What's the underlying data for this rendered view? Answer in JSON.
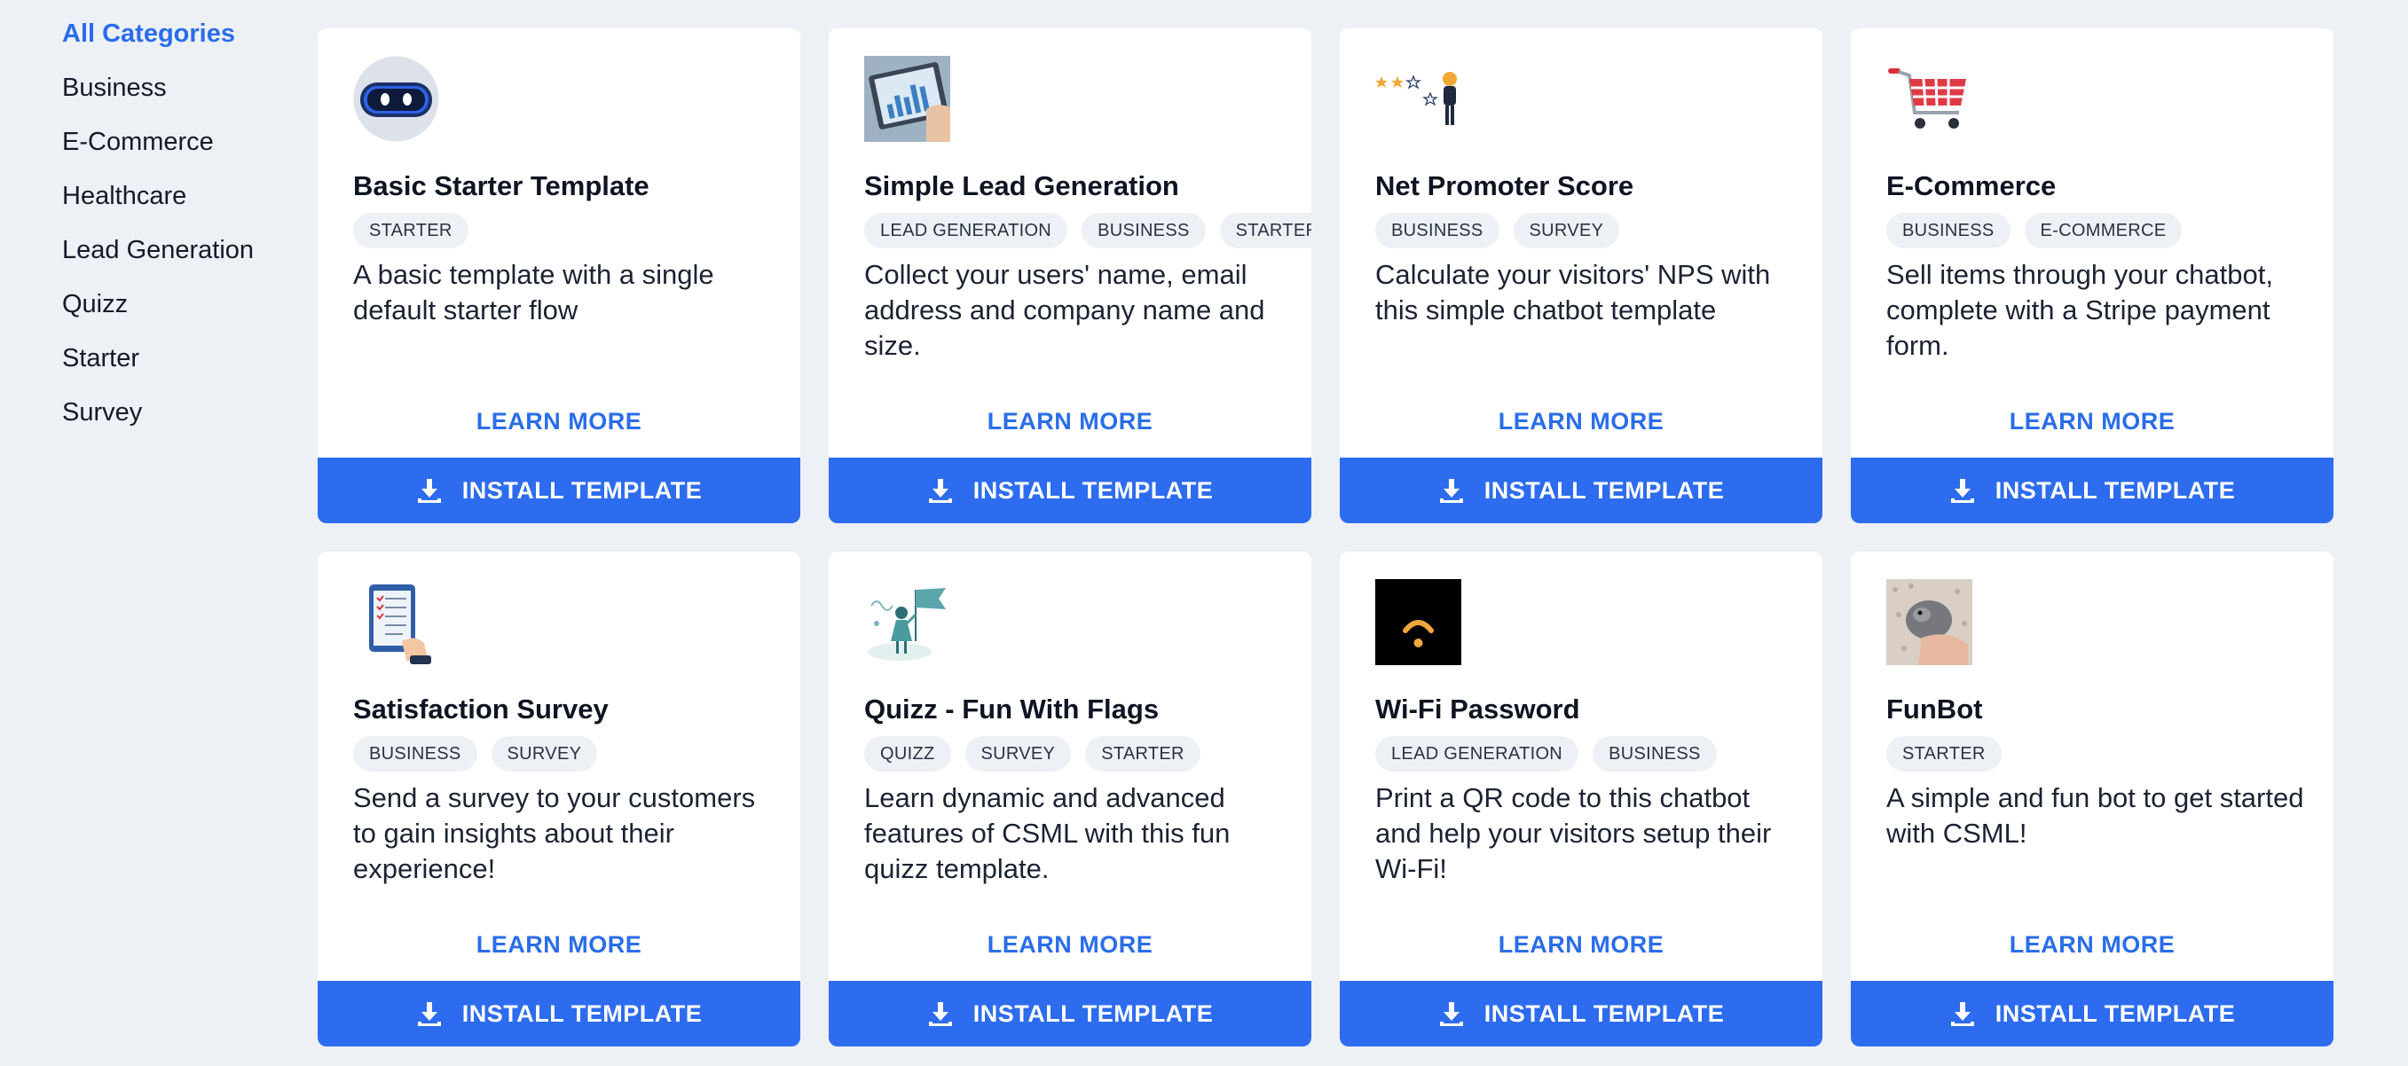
{
  "sidebar": {
    "items": [
      {
        "label": "All Categories",
        "active": true
      },
      {
        "label": "Business"
      },
      {
        "label": "E-Commerce"
      },
      {
        "label": "Healthcare"
      },
      {
        "label": "Lead Generation"
      },
      {
        "label": "Quizz"
      },
      {
        "label": "Starter"
      },
      {
        "label": "Survey"
      }
    ]
  },
  "cards": [
    {
      "title": "Basic Starter Template",
      "icon": "robot-face-icon",
      "tags": [
        "STARTER"
      ],
      "description": "A basic template with a single default starter flow",
      "learn_more": "LEARN MORE",
      "install": "INSTALL TEMPLATE"
    },
    {
      "title": "Simple Lead Generation",
      "icon": "tablet-chart-photo-icon",
      "tags": [
        "LEAD GENERATION",
        "BUSINESS",
        "STARTER"
      ],
      "description": "Collect your users' name, email address and company name and size.",
      "learn_more": "LEARN MORE",
      "install": "INSTALL TEMPLATE"
    },
    {
      "title": "Net Promoter Score",
      "icon": "star-rating-icon",
      "tags": [
        "BUSINESS",
        "SURVEY"
      ],
      "description": "Calculate your visitors' NPS with this simple chatbot template",
      "learn_more": "LEARN MORE",
      "install": "INSTALL TEMPLATE"
    },
    {
      "title": "E-Commerce",
      "icon": "shopping-cart-icon",
      "tags": [
        "BUSINESS",
        "E-COMMERCE"
      ],
      "description": "Sell items through your chatbot, complete with a Stripe payment form.",
      "learn_more": "LEARN MORE",
      "install": "INSTALL TEMPLATE"
    },
    {
      "title": "Satisfaction Survey",
      "icon": "survey-checklist-icon",
      "tags": [
        "BUSINESS",
        "SURVEY"
      ],
      "description": "Send a survey to your customers to gain insights about their experience!",
      "learn_more": "LEARN MORE",
      "install": "INSTALL TEMPLATE"
    },
    {
      "title": "Quizz - Fun With Flags",
      "icon": "flag-girl-icon",
      "tags": [
        "QUIZZ",
        "SURVEY",
        "STARTER"
      ],
      "description": "Learn dynamic and advanced features of CSML with this fun quizz template.",
      "learn_more": "LEARN MORE",
      "install": "INSTALL TEMPLATE"
    },
    {
      "title": "Wi-Fi Password",
      "icon": "wifi-icon",
      "tags": [
        "LEAD GENERATION",
        "BUSINESS"
      ],
      "description": "Print a QR code to this chatbot and help your visitors setup their Wi-Fi!",
      "learn_more": "LEARN MORE",
      "install": "INSTALL TEMPLATE"
    },
    {
      "title": "FunBot",
      "icon": "hamster-photo-icon",
      "tags": [
        "STARTER"
      ],
      "description": "A simple and fun bot to get started with CSML!",
      "learn_more": "LEARN MORE",
      "install": "INSTALL TEMPLATE"
    }
  ],
  "colors": {
    "accent": "#2d6cee",
    "background": "#edf0f5",
    "text": "#0f1422"
  }
}
